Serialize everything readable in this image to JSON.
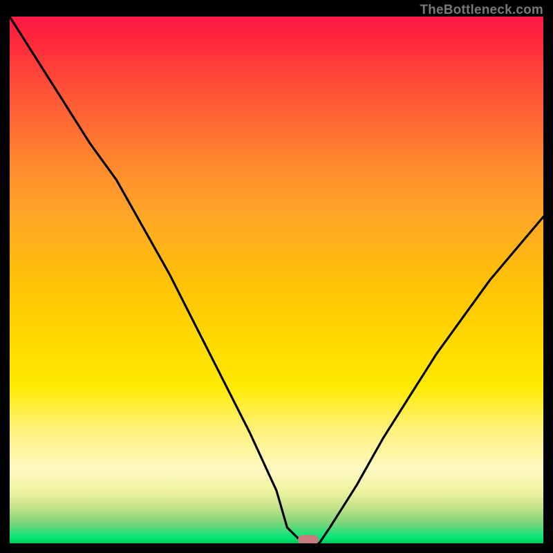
{
  "watermark": "TheBottleneck.com",
  "colors": {
    "background": "#000000",
    "curve": "#000000",
    "marker": "#c97b7b"
  },
  "chart_data": {
    "type": "line",
    "title": "",
    "xlabel": "",
    "ylabel": "",
    "xlim": [
      0,
      100
    ],
    "ylim": [
      0,
      100
    ],
    "grid": false,
    "series": [
      {
        "name": "bottleneck-curve",
        "x": [
          0,
          5,
          10,
          15,
          20,
          25,
          30,
          35,
          40,
          45,
          50,
          52,
          55,
          58,
          60,
          65,
          70,
          75,
          80,
          85,
          90,
          95,
          100
        ],
        "values": [
          100,
          92,
          84,
          76,
          69,
          60,
          51,
          41,
          31,
          21,
          10,
          3,
          0,
          0,
          3,
          11,
          20,
          28,
          36,
          43,
          50,
          56,
          62
        ]
      }
    ],
    "marker": {
      "x": 56,
      "y": 0
    }
  }
}
